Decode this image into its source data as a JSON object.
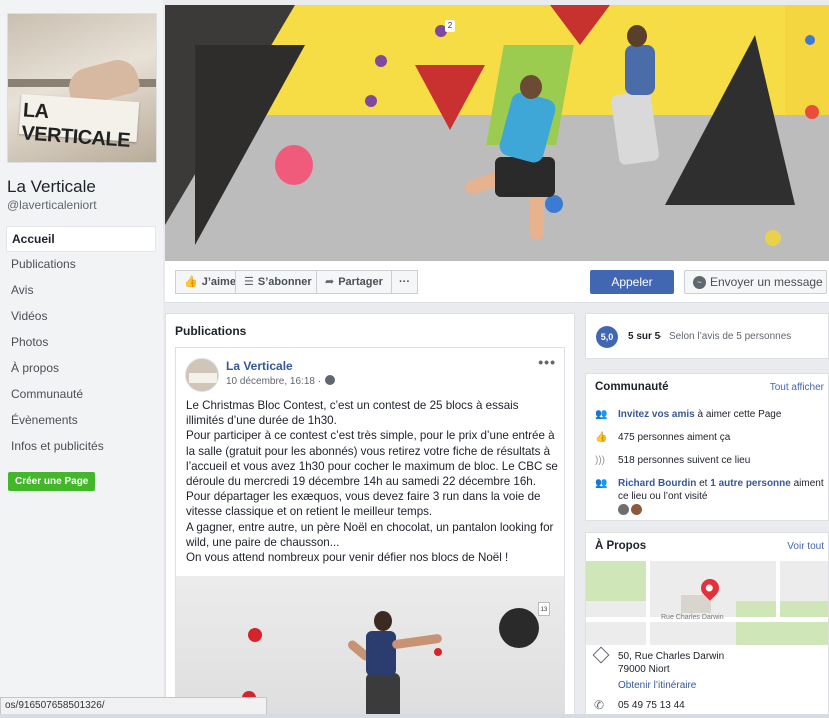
{
  "page": {
    "name": "La Verticale",
    "handle": "@laverticaleniort",
    "logo_text": "LA VERTICALE"
  },
  "nav": {
    "items": [
      "Accueil",
      "Publications",
      "Avis",
      "Vidéos",
      "Photos",
      "À propos",
      "Communauté",
      "Évènements",
      "Infos et publicités"
    ],
    "active": "Accueil",
    "create_page": "Créer une Page"
  },
  "actions": {
    "like": "J’aime",
    "subscribe": "S’abonner",
    "share": "Partager",
    "more": "···",
    "call": "Appeler",
    "message": "Envoyer un message"
  },
  "publications": {
    "title": "Publications",
    "post": {
      "author": "La Verticale",
      "time": "10 décembre, 16:18 ·",
      "menu": "•••",
      "paragraphs": [
        "Le Christmas Bloc Contest, c’est un contest de 25 blocs à essais illimités d’une durée de 1h30.",
        "Pour participer à ce contest c’est très simple, pour le prix d’une entrée à la salle (gratuit pour les abonnés) vous retirez votre fiche de résultats à l’accueil et vous avez 1h30 pour cocher le maximum de bloc. Le CBC se déroule du mercredi 19 décembre 14h au samedi 22 décembre 16h.",
        "Pour départager les exæquos, vous devez faire 3 run dans la voie de vitesse classique et on retient le meilleur temps.",
        "A gagner, entre autre, un père Noël en chocolat, un pantalon looking for wild, une paire de chausson...",
        "On vous attend nombreux pour venir défier nos blocs de Noël !"
      ],
      "image_tag": "13"
    }
  },
  "rating": {
    "badge": "5,0",
    "score": "5 sur 5",
    "dot": "·",
    "text": "Selon l’avis de 5 personnes"
  },
  "community": {
    "title": "Communauté",
    "see_all": "Tout afficher",
    "invite_link": "Invitez vos amis",
    "invite_rest": " à aimer cette Page",
    "likes": "475 personnes aiment ça",
    "follows": "518 personnes suivent ce lieu",
    "friends_link1": "Richard Bourdin",
    "friends_mid": " et ",
    "friends_link2": "1 autre personne",
    "friends_rest": " aiment ce lieu ou l’ont visité"
  },
  "about": {
    "title": "À Propos",
    "see_all": "Voir tout",
    "map_road": "Rue Charles Darwin",
    "street": "50, Rue Charles Darwin",
    "city": "79000 Niort",
    "route": "Obtenir l’itinéraire",
    "phone": "05 49 75 13 44"
  },
  "status_bar": {
    "url": "os/916507658501326/"
  },
  "cover": {
    "hold_number": "2"
  },
  "colors": {
    "facebook_blue": "#4267b2",
    "create_green": "#42b72a",
    "link": "#365899"
  }
}
